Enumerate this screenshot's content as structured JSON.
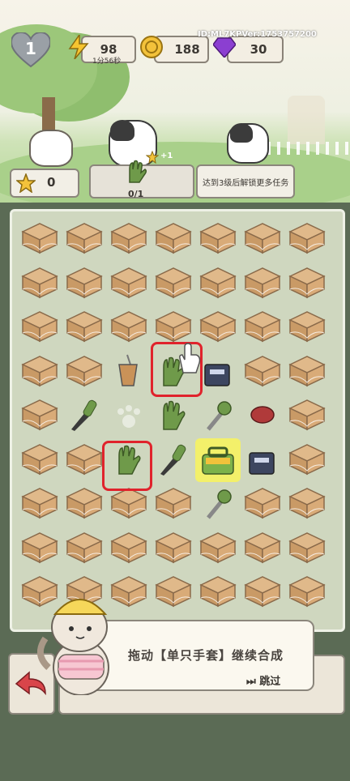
{
  "hud": {
    "level": "1",
    "energy": "98",
    "energy_timer": "1分56秒",
    "coins": "188",
    "gems": "30",
    "id_version": "ID:ML7KPVer:1753757200"
  },
  "orders": {
    "stars": "0",
    "reward_plus": "+1",
    "progress": "0/1",
    "locked_text": "达到3级后解锁更多任务"
  },
  "tutorial": {
    "message": "拖动【单只手套】继续合成",
    "skip_label": "跳过"
  },
  "colors": {
    "highlight": "#e0232c",
    "selected_cell": "#f3f06a",
    "accent_green": "#7db24a",
    "gem_purple": "#8b3fd1"
  },
  "board_items": [
    [
      "box",
      "box",
      "box",
      "box",
      "box",
      "box",
      "box"
    ],
    [
      "box",
      "box",
      "box",
      "box",
      "box",
      "box",
      "box"
    ],
    [
      "box",
      "box",
      "box",
      "box",
      "box",
      "box",
      "box"
    ],
    [
      "box",
      "box",
      "drink-cup-icon",
      "glove-icon",
      "wrench-crate-icon",
      "box",
      "box"
    ],
    [
      "box",
      "knife-icon",
      "paw-icon",
      "glove-icon",
      "wrench-icon",
      "meat-icon",
      "box"
    ],
    [
      "box",
      "box",
      "glove-icon",
      "knife-icon",
      "toolbox-icon",
      "wrench-crate-icon",
      "box"
    ],
    [
      "box",
      "box",
      "box",
      "box",
      "wrench-icon",
      "box",
      "box"
    ],
    [
      "box",
      "box",
      "box",
      "box",
      "box",
      "box",
      "box"
    ],
    [
      "box",
      "box",
      "box",
      "box",
      "box",
      "box",
      "box"
    ]
  ]
}
